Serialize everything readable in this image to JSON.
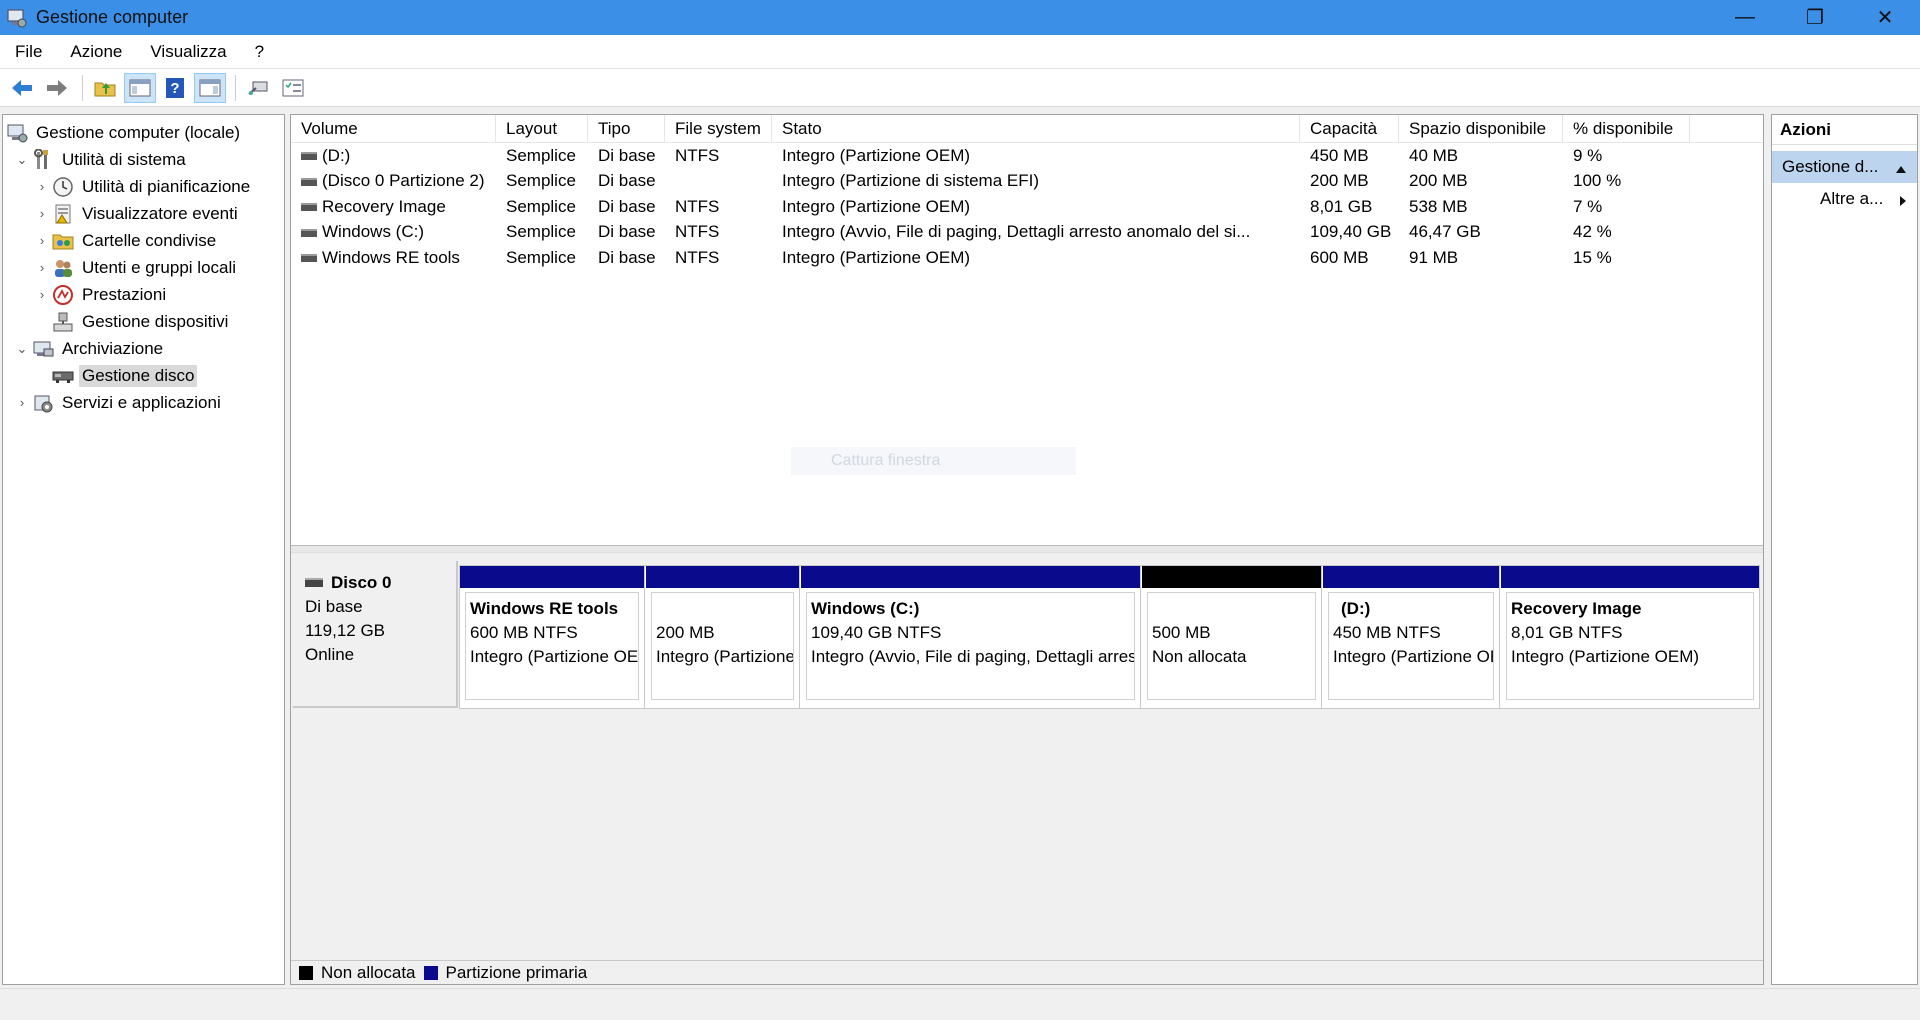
{
  "window": {
    "title": "Gestione computer",
    "controls": {
      "minimize": "—",
      "restore": "❐",
      "close": "✕"
    }
  },
  "menu": [
    "File",
    "Azione",
    "Visualizza",
    "?"
  ],
  "toolbar": {
    "buttons": [
      "back-arrow-icon",
      "forward-arrow-icon",
      "up-folder-icon",
      "show-hide-tree-icon",
      "help-icon",
      "show-hide-action-icon",
      "connect-icon",
      "properties-icon"
    ]
  },
  "tree": {
    "root": "Gestione computer (locale)",
    "items": [
      {
        "label": "Utilità di sistema",
        "arrow": "⌄",
        "level": 1
      },
      {
        "label": "Utilità di pianificazione",
        "arrow": "›",
        "level": 2
      },
      {
        "label": "Visualizzatore eventi",
        "arrow": "›",
        "level": 2
      },
      {
        "label": "Cartelle condivise",
        "arrow": "›",
        "level": 2
      },
      {
        "label": "Utenti e gruppi locali",
        "arrow": "›",
        "level": 2
      },
      {
        "label": "Prestazioni",
        "arrow": "›",
        "level": 2
      },
      {
        "label": "Gestione dispositivi",
        "arrow": "",
        "level": 2
      },
      {
        "label": "Archiviazione",
        "arrow": "⌄",
        "level": 1
      },
      {
        "label": "Gestione disco",
        "arrow": "",
        "level": 2
      },
      {
        "label": "Servizi e applicazioni",
        "arrow": "›",
        "level": 1
      }
    ]
  },
  "volumes": {
    "columns": [
      "Volume",
      "Layout",
      "Tipo",
      "File system",
      "Stato",
      "Capacità",
      "Spazio disponibile",
      "% disponibile"
    ],
    "rows": [
      {
        "volume": "(D:)",
        "layout": "Semplice",
        "tipo": "Di base",
        "fs": "NTFS",
        "stato": "Integro (Partizione OEM)",
        "cap": "450 MB",
        "free": "40 MB",
        "pct": "9 %"
      },
      {
        "volume": "(Disco 0 Partizione 2)",
        "layout": "Semplice",
        "tipo": "Di base",
        "fs": "",
        "stato": "Integro (Partizione di sistema EFI)",
        "cap": "200 MB",
        "free": "200 MB",
        "pct": "100 %"
      },
      {
        "volume": "Recovery Image",
        "layout": "Semplice",
        "tipo": "Di base",
        "fs": "NTFS",
        "stato": "Integro (Partizione OEM)",
        "cap": "8,01 GB",
        "free": "538 MB",
        "pct": "7 %"
      },
      {
        "volume": "Windows (C:)",
        "layout": "Semplice",
        "tipo": "Di base",
        "fs": "NTFS",
        "stato": "Integro (Avvio, File di paging, Dettagli arresto anomalo del si...",
        "cap": "109,40 GB",
        "free": "46,47 GB",
        "pct": "42 %"
      },
      {
        "volume": "Windows RE tools",
        "layout": "Semplice",
        "tipo": "Di base",
        "fs": "NTFS",
        "stato": "Integro (Partizione OEM)",
        "cap": "600 MB",
        "free": "91 MB",
        "pct": "15 %"
      }
    ],
    "watermark": "Cattura finestra"
  },
  "disk": {
    "name": "Disco 0",
    "type": "Di base",
    "size": "119,12 GB",
    "status": "Online",
    "partitions": [
      {
        "name": "Windows RE tools",
        "line1": "600 MB NTFS",
        "line2": "Integro (Partizione OEM)",
        "color": "#0a0a8c"
      },
      {
        "name": "",
        "line1": "200 MB",
        "line2": "Integro (Partizione di sistema EFI)",
        "color": "#0a0a8c"
      },
      {
        "name": "Windows  (C:)",
        "line1": "109,40 GB NTFS",
        "line2": "Integro (Avvio, File di paging, Dettagli arresto anomalo del sistema)",
        "color": "#0a0a8c"
      },
      {
        "name": "",
        "line1": "500 MB",
        "line2": "Non allocata",
        "color": "#000000"
      },
      {
        "name": "(D:)",
        "line1": "450 MB NTFS",
        "line2": "Integro (Partizione OEM)",
        "color": "#0a0a8c"
      },
      {
        "name": "Recovery Image",
        "line1": "8,01 GB NTFS",
        "line2": "Integro (Partizione OEM)",
        "color": "#0a0a8c"
      }
    ]
  },
  "legend": [
    {
      "label": "Non allocata",
      "color": "#000000"
    },
    {
      "label": "Partizione primaria",
      "color": "#0a0a8c"
    }
  ],
  "actions": {
    "header": "Azioni",
    "selected": "Gestione d...",
    "more": "Altre a..."
  },
  "colors": {
    "titlebar": "#3c8fe6",
    "selection": "#bcd4ee",
    "primary_partition": "#0a0a8c"
  }
}
